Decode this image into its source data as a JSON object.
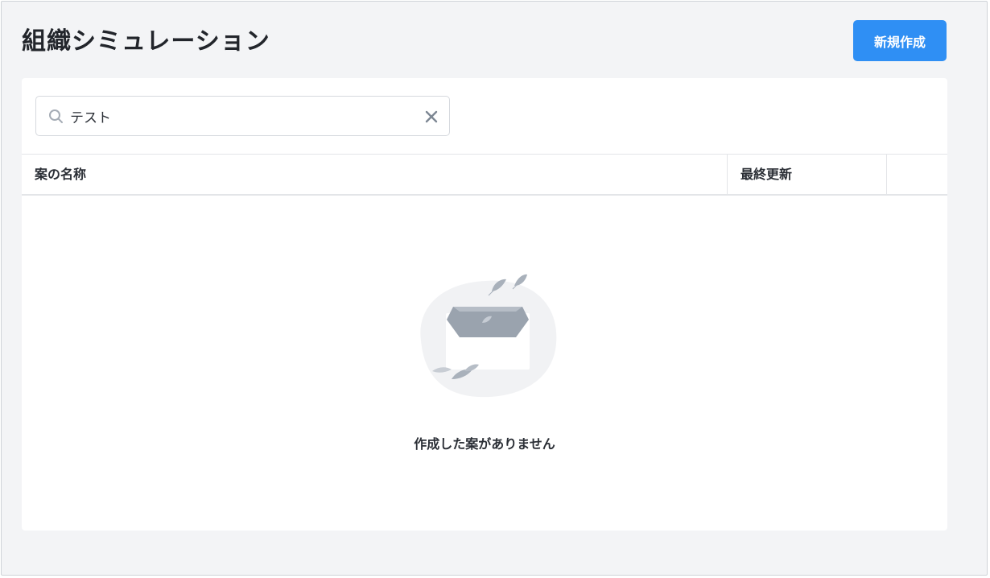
{
  "page": {
    "title": "組織シミュレーション",
    "new_button_label": "新規作成"
  },
  "search": {
    "value": "テスト",
    "icon": "search-icon",
    "clear_icon": "close-icon"
  },
  "table": {
    "columns": [
      "案の名称",
      "最終更新",
      ""
    ]
  },
  "empty_state": {
    "icon": "empty-inbox-illustration",
    "message": "作成した案がありません"
  },
  "colors": {
    "accent": "#2f8ff4",
    "background": "#f3f4f6",
    "illustration": "#9aa3ae"
  }
}
